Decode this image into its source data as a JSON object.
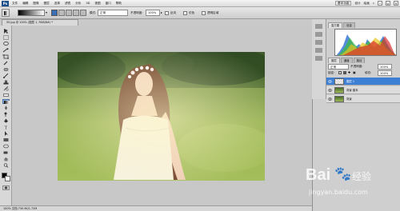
{
  "menu": {
    "logo": "Ps",
    "items": [
      "文件",
      "编辑",
      "图像",
      "图层",
      "选择",
      "滤镜",
      "分析",
      "3D",
      "视图",
      "窗口",
      "帮助"
    ],
    "workspace_basic": "基本功能",
    "workspace_design": "设计",
    "workspace_paint": "绘画",
    "more": "»"
  },
  "options": {
    "mode_label": "模式:",
    "mode_value": "正常",
    "opacity_label": "不透明度:",
    "opacity_value": "100%",
    "reverse_label": "反向",
    "dither_label": "仿色",
    "transparency_label": "透明区域"
  },
  "document": {
    "tab_title": "55.jpg @ 100% (图层 1, RGB/8#) *",
    "status_text": "100%   文档:730.9K/1.72M"
  },
  "panels": {
    "histogram_tabs": [
      "直方图",
      "信息"
    ],
    "layers_tabs": [
      "图层",
      "通道",
      "路径"
    ],
    "blend_mode": "正常",
    "opacity_label": "不透明度:",
    "opacity_value": "100%",
    "lock_label": "锁定:",
    "fill_label": "填充:",
    "fill_value": "100%",
    "layers": [
      {
        "name": "图层 1",
        "selected": true
      },
      {
        "name": "背景 副本",
        "selected": false
      },
      {
        "name": "背景",
        "selected": false
      }
    ]
  },
  "watermark": {
    "brand": "Bai",
    "brand2": "经验",
    "url": "jingyan.baidu.com"
  },
  "colors": {
    "selection_blue": "#3e7fd6",
    "grass_green": "#8fb04a"
  }
}
